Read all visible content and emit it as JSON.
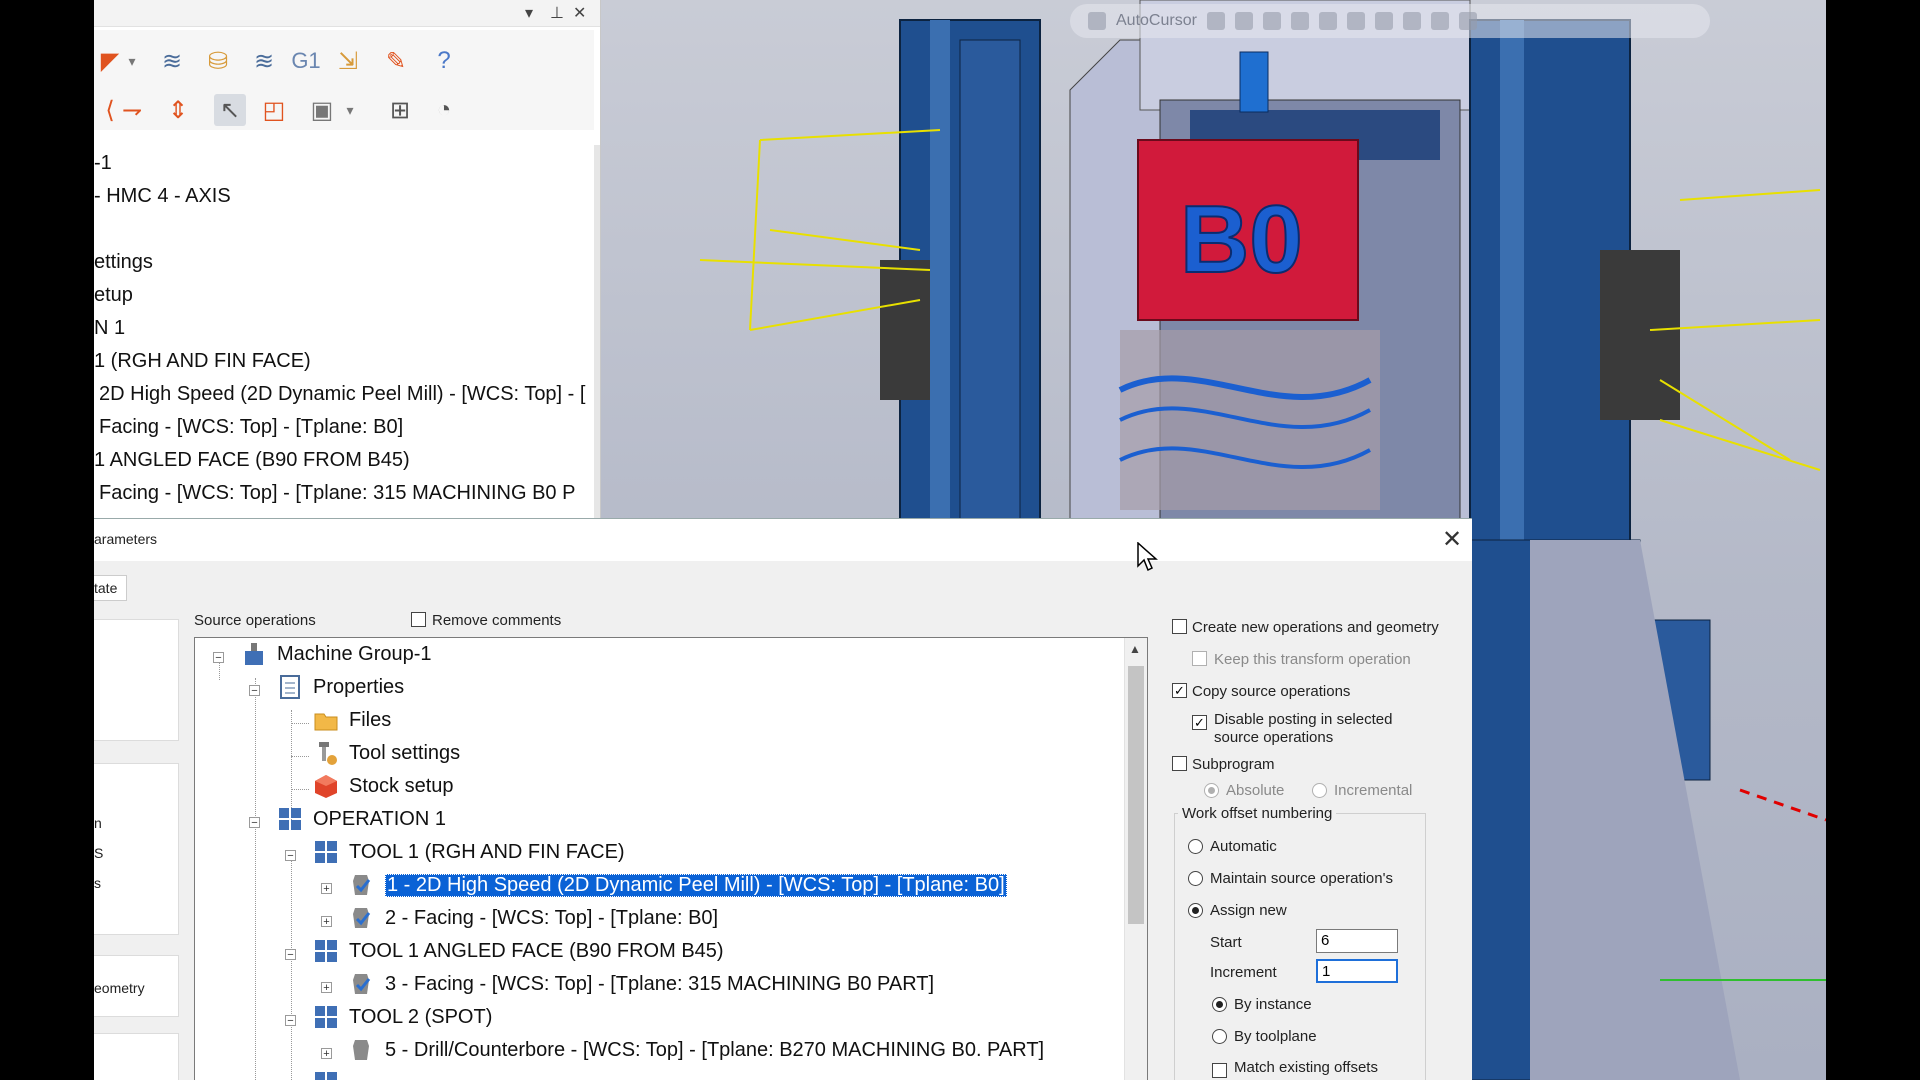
{
  "viewport": {
    "toolbar_autocursor": "AutoCursor",
    "part_label": "B0"
  },
  "manager": {
    "tree_rows": [
      "-1",
      "- HMC 4 - AXIS",
      "ettings",
      "etup",
      "N 1",
      "1 (RGH AND FIN FACE)",
      "2D High Speed (2D Dynamic Peel Mill) - [WCS: Top] - [",
      "Facing - [WCS: Top] - [Tplane: B0]",
      "1 ANGLED FACE (B90 FROM B45)",
      "Facing - [WCS: Top] - [Tplane: 315 MACHINING B0 P"
    ],
    "toolbar_icons": [
      "dropdown-icon",
      "toolpath-icon",
      "verify-icon",
      "backplot-icon",
      "g1-icon",
      "post-icon",
      "edit-icon",
      "help-icon",
      "transform-icon",
      "move-icon",
      "select-icon",
      "shape-icon",
      "view-icon",
      "display-icon",
      "render-icon"
    ],
    "g1_label": "G1"
  },
  "dialog": {
    "title": "arameters",
    "tab": "tate",
    "left_labels": [
      "n",
      "S",
      "s",
      "eometry"
    ],
    "source_operations_label": "Source operations",
    "remove_comments_label": "Remove comments",
    "tree": {
      "machine_group": "Machine Group-1",
      "properties": "Properties",
      "files": "Files",
      "tool_settings": "Tool settings",
      "stock_setup": "Stock setup",
      "operation_1": "OPERATION 1",
      "tool_1": "TOOL 1 (RGH AND FIN FACE)",
      "op_1": "1 - 2D High Speed (2D Dynamic Peel Mill) - [WCS: Top] - [Tplane: B0]",
      "op_2": "2 - Facing - [WCS: Top] - [Tplane: B0]",
      "tool_1_angled": "TOOL 1 ANGLED FACE (B90 FROM B45)",
      "op_3": "3 - Facing - [WCS: Top] - [Tplane: 315 MACHINING B0 PART]",
      "tool_2": "TOOL 2 (SPOT)",
      "op_5": "5 - Drill/Counterbore - [WCS: Top] - [Tplane: B270 MACHINING B0. PART]"
    },
    "options": {
      "create_new": "Create new operations and geometry",
      "keep_transform": "Keep this transform operation",
      "copy_source": "Copy source operations",
      "disable_posting": "Disable posting in selected",
      "disable_posting_2": "source operations",
      "subprogram": "Subprogram",
      "absolute": "Absolute",
      "incremental": "Incremental",
      "work_offset_numbering": "Work offset numbering",
      "automatic": "Automatic",
      "maintain": "Maintain source operation's",
      "assign_new": "Assign new",
      "start_label": "Start",
      "start_value": "6",
      "increment_label": "Increment",
      "increment_value": "1",
      "by_instance": "By instance",
      "by_toolplane": "By toolplane",
      "match_existing": "Match existing offsets"
    },
    "state": {
      "remove_comments": false,
      "create_new": false,
      "keep_transform": false,
      "copy_source": true,
      "disable_posting": true,
      "subprogram": false,
      "absolute": true,
      "incremental": false,
      "automatic": false,
      "maintain": false,
      "assign_new": true,
      "by_instance": true,
      "by_toolplane": false,
      "match_existing": false
    }
  },
  "colors": {
    "selection": "#0a62d6",
    "part_red": "#d11a3b",
    "fixture_blue": "#1f4f8f",
    "toolpath_yellow": "#e8e000"
  }
}
